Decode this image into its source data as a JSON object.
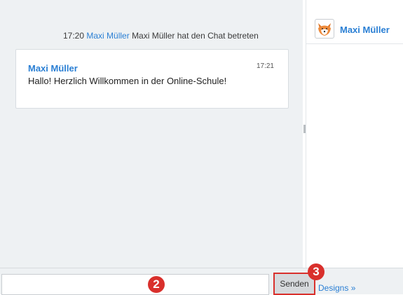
{
  "chat": {
    "system_time": "17:20",
    "system_user": "Maxi Müller",
    "system_text": "Maxi Müller hat den Chat betreten",
    "message": {
      "author": "Maxi Müller",
      "time": "17:21",
      "text": "Hallo! Herzlich Willkommen in der Online-Schule!"
    }
  },
  "users": [
    {
      "name": "Maxi Müller",
      "avatar_icon": "fox-avatar-icon"
    }
  ],
  "composer": {
    "input_value": "",
    "send_label": "Senden",
    "designs_label": "Designs »"
  },
  "annotations": {
    "badge_2": "2",
    "badge_3": "3"
  },
  "colors": {
    "accent": "#2a7fd4",
    "highlight": "#d9302c",
    "pane_bg": "#eef1f3"
  }
}
